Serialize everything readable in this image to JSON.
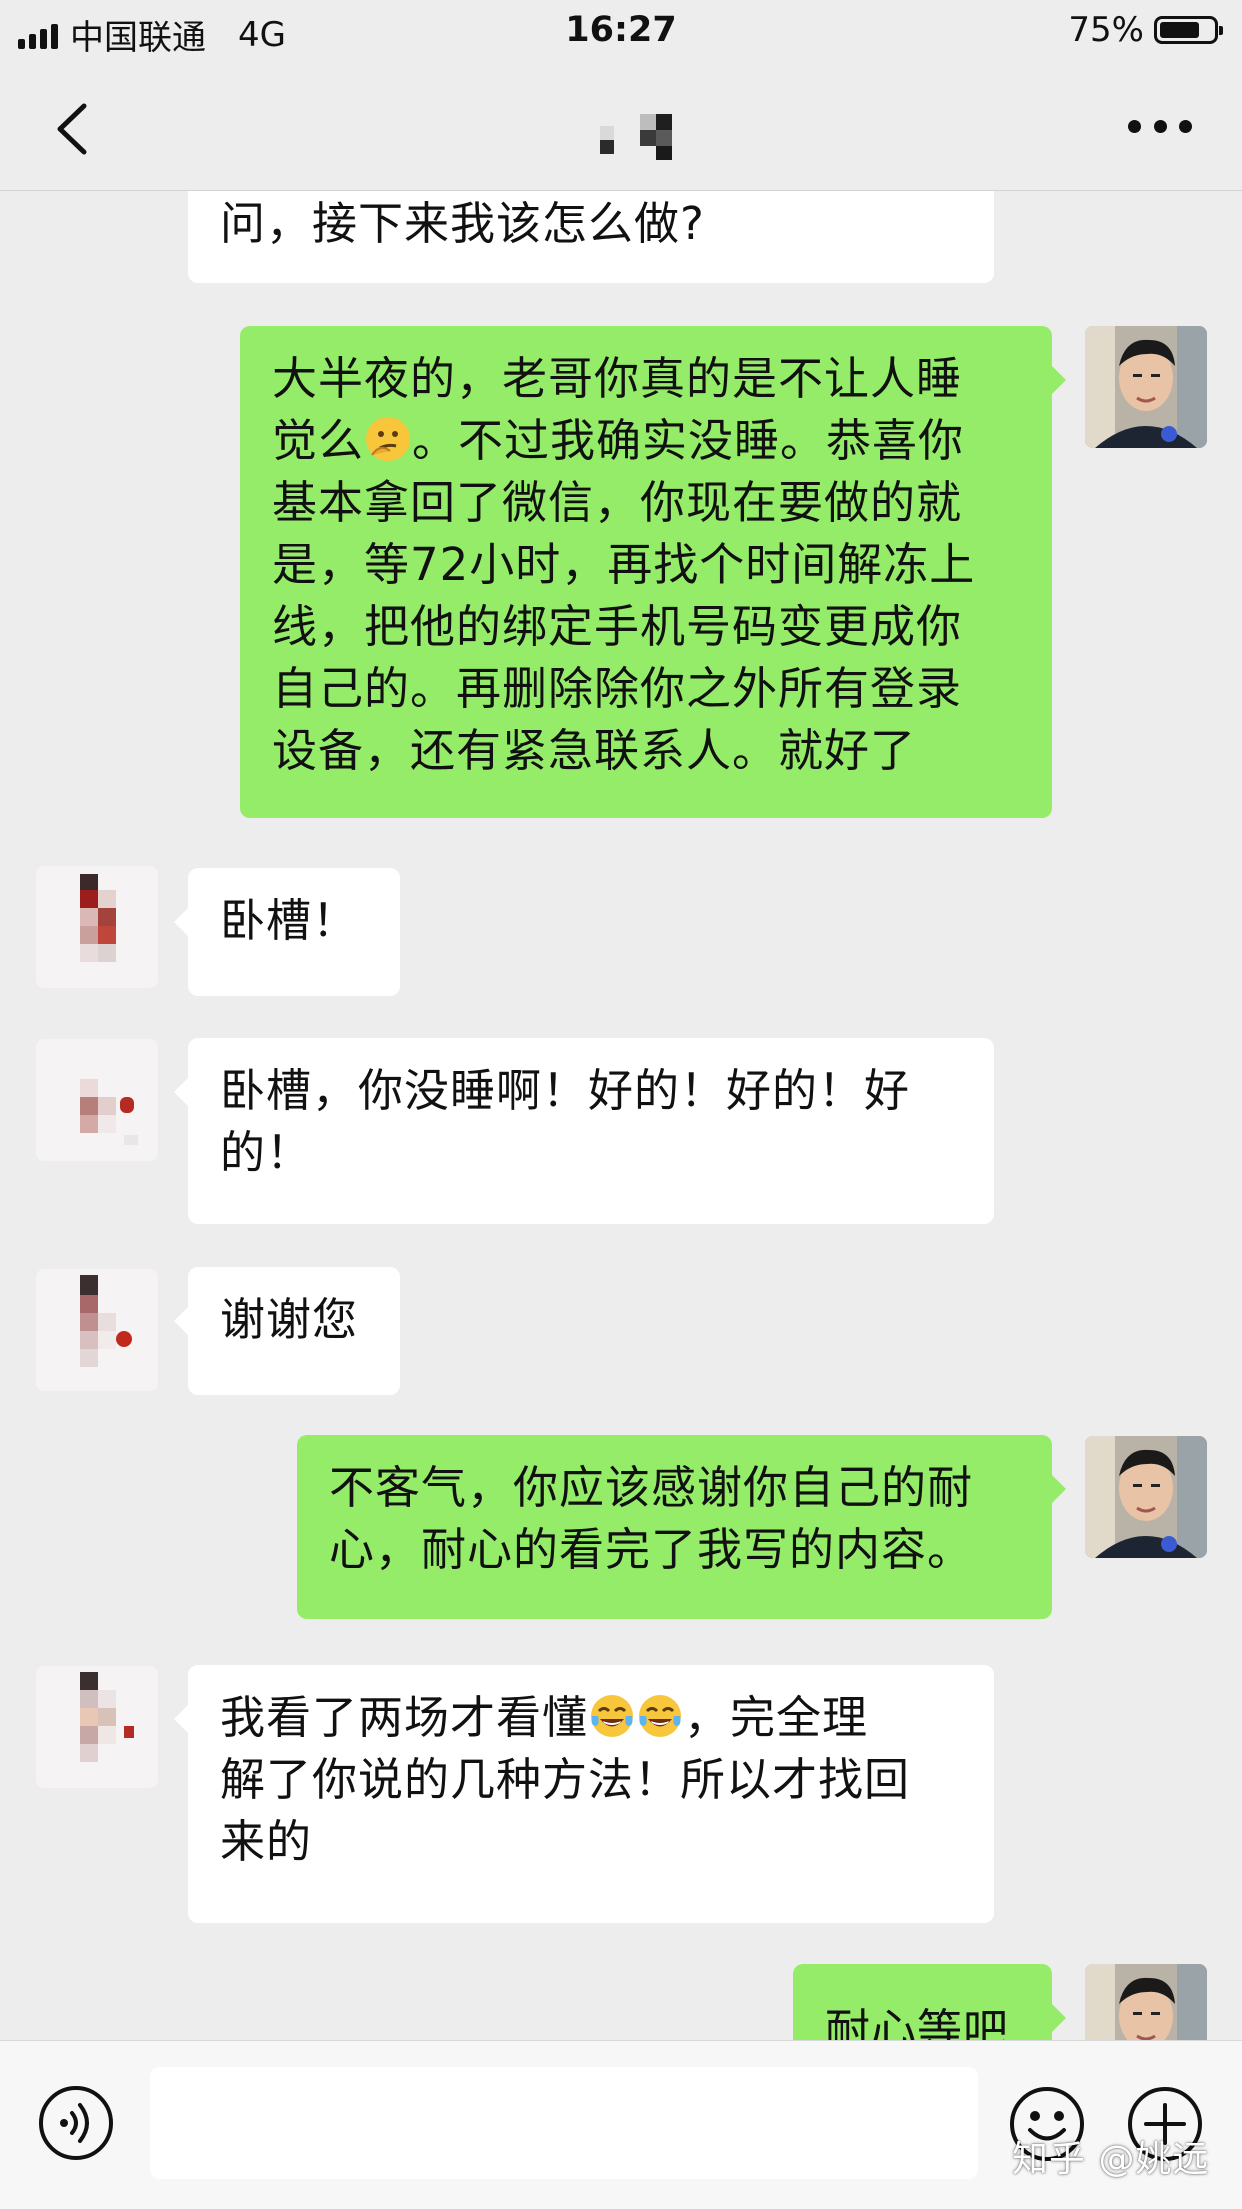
{
  "status_bar": {
    "carrier": "中国联通",
    "network": "4G",
    "time": "16:27",
    "battery_text": "75%",
    "battery_level": 0.75
  },
  "nav": {
    "back_icon": "chevron-left-icon",
    "title_obscured": true,
    "more_icon": "more-dots-icon"
  },
  "messages": [
    {
      "from": "contact",
      "text": "问，接下来我该怎么做?",
      "continued": true
    },
    {
      "from": "self",
      "text": "大半夜的，老哥你真的是不让人睡觉么🤔。不过我确实没睡。恭喜你基本拿回了微信，你现在要做的就是，等72小时，再找个时间解冻上线，把他的绑定手机号码变更成你自己的。再删除除你之外所有登录设备，还有紧急联系人。就好了"
    },
    {
      "from": "contact",
      "text": "卧槽！"
    },
    {
      "from": "contact",
      "text": "卧槽，你没睡啊！好的！好的！好的！"
    },
    {
      "from": "contact",
      "text": "谢谢您"
    },
    {
      "from": "self",
      "text": "不客气，你应该感谢你自己的耐心，耐心的看完了我写的内容。"
    },
    {
      "from": "contact",
      "text": "我看了两场才看懂😂😂，完全理解了你说的几种方法！所以才找回来的"
    },
    {
      "from": "self",
      "text": "耐心等吧"
    }
  ],
  "message_lines": {
    "m0": [
      "问，接下来我该怎么做?"
    ],
    "m1": [
      "大半夜的，老哥你真的是不让人睡",
      "觉么",
      "。不过我确实没睡。恭喜你",
      "基本拿回了微信，你现在要做的就",
      "是，等72小时，再找个时间解冻上",
      "线，把他的绑定手机号码变更成你",
      "自己的。再删除除你之外所有登录",
      "设备，还有紧急联系人。就好了"
    ],
    "m2": [
      "卧槽！"
    ],
    "m3": [
      "卧槽，你没睡啊！好的！好的！好",
      "的！"
    ],
    "m4": [
      "谢谢您"
    ],
    "m5": [
      "不客气，你应该感谢你自己的耐",
      "心，耐心的看完了我写的内容。"
    ],
    "m6": [
      "我看了两场才看懂",
      "，完全理",
      "解了你说的几种方法！所以才找回",
      "来的"
    ],
    "m7": [
      "耐心等吧"
    ]
  },
  "input_bar": {
    "voice_icon": "voice-icon",
    "emoji_icon": "emoji-icon",
    "plus_icon": "plus-icon"
  },
  "watermark": "知乎 @姚远",
  "colors": {
    "background": "#ededed",
    "self_bubble": "#95ec69",
    "contact_bubble": "#ffffff"
  }
}
